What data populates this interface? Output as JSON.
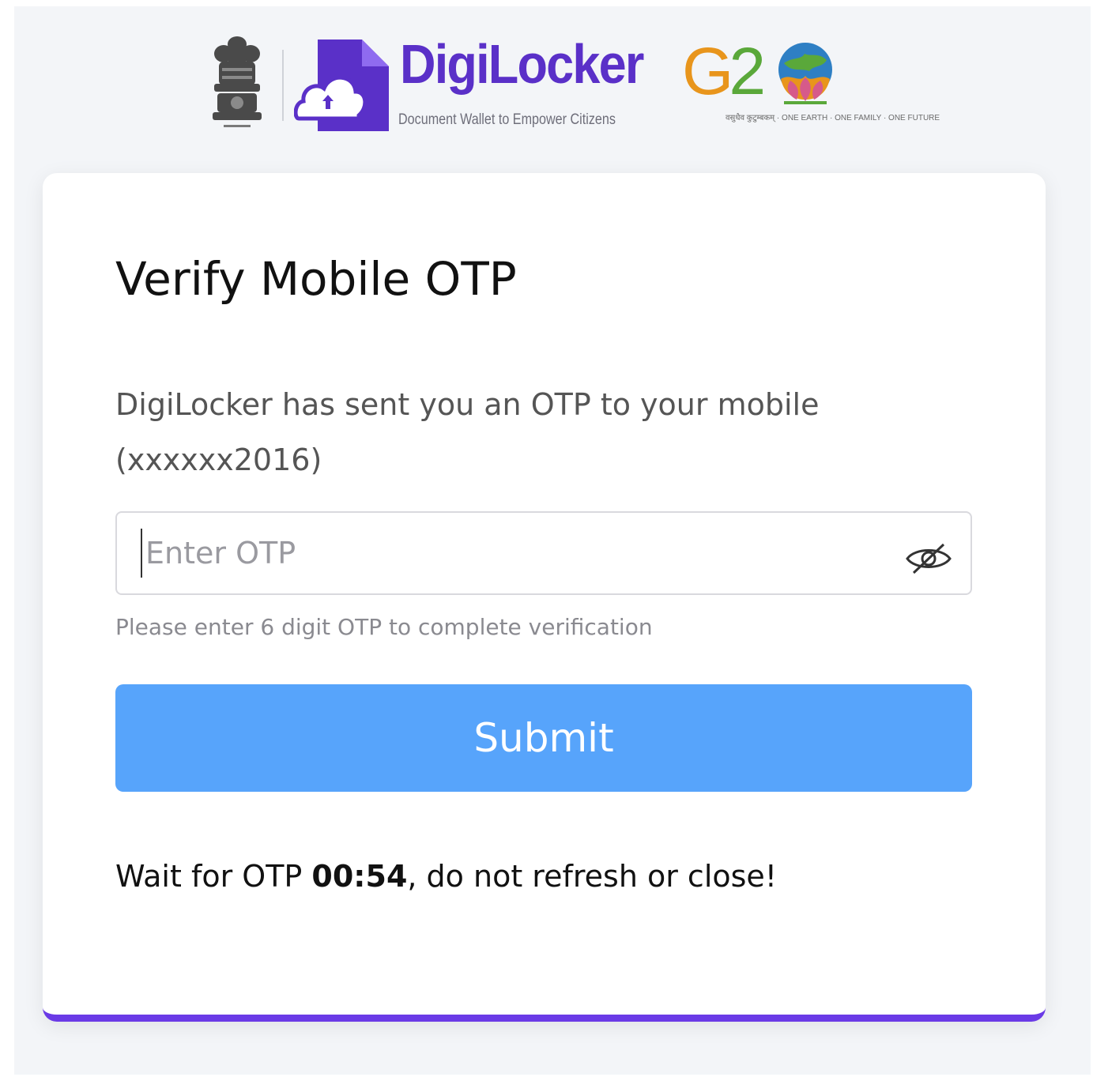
{
  "header": {
    "brand_name": "DigiLocker",
    "tagline": "Document Wallet to Empower Citizens",
    "g20_prefix": "G",
    "g20_number": "2",
    "g20_sub": "वसुधैव कुटुम्बकम् · ONE EARTH · ONE FAMILY · ONE FUTURE"
  },
  "card": {
    "title": "Verify Mobile OTP",
    "description": "DigiLocker has sent you an OTP to your mobile (xxxxxx2016)",
    "otp_input": {
      "placeholder": "Enter OTP",
      "value": ""
    },
    "hint": "Please enter 6 digit OTP to complete verification",
    "submit_label": "Submit",
    "wait": {
      "prefix": "Wait for OTP ",
      "timer": "00:54",
      "suffix": ", do not refresh or close!"
    }
  },
  "colors": {
    "brand_purple": "#5a30c8",
    "card_accent": "#6a3ae6",
    "submit_blue": "#57a4fb",
    "g20_orange": "#e8951c",
    "g20_green": "#5aa83a"
  },
  "icons": {
    "emblem": "state-emblem-icon",
    "brand": "digilocker-logo-icon",
    "globe": "g20-globe-icon",
    "password_toggle": "eye-slash-icon"
  }
}
